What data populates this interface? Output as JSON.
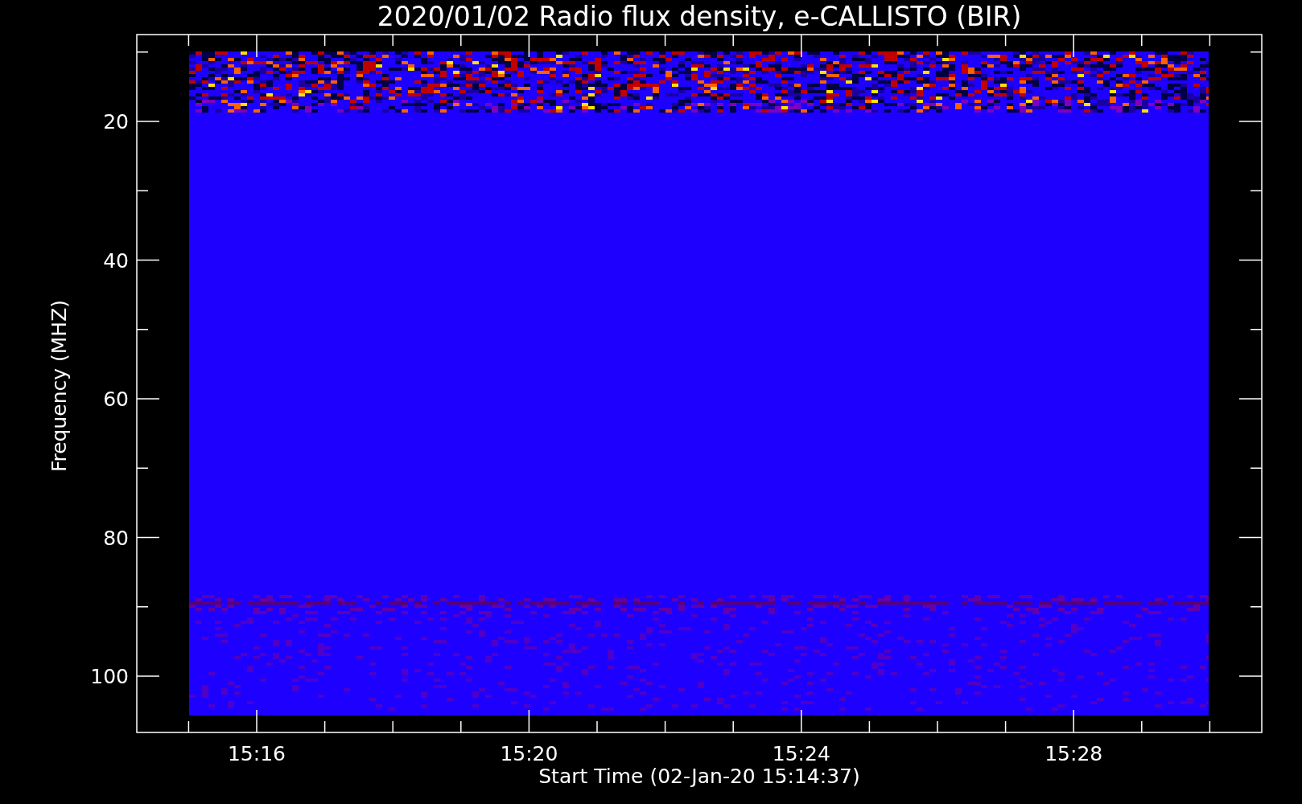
{
  "title": "2020/01/02  Radio flux density, e-CALLISTO (BIR)",
  "y_axis": {
    "label": "Frequency (MHZ)",
    "ticks": [
      "20",
      "40",
      "60",
      "80",
      "100"
    ]
  },
  "x_axis": {
    "label": "Start Time (02-Jan-20 15:14:37)",
    "ticks": [
      "15:16",
      "15:20",
      "15:24",
      "15:28"
    ]
  }
}
